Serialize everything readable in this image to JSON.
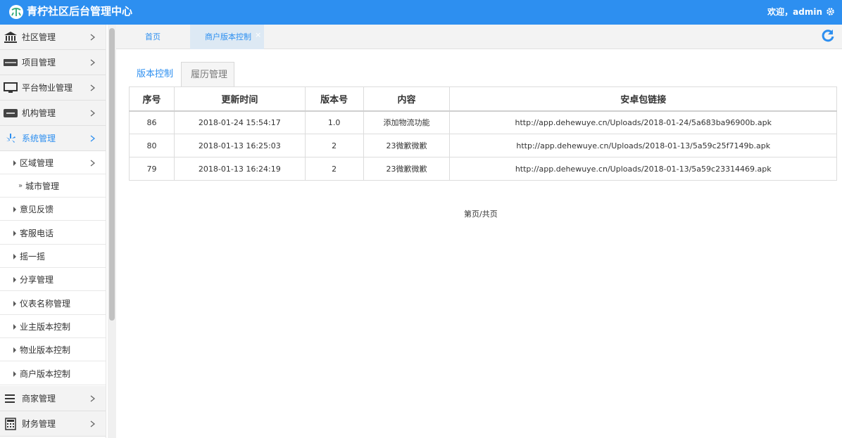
{
  "app": {
    "title": "青柠社区后台管理中心",
    "logo_icon": "leaf-logo-icon",
    "accent_color": "#2d8ff0"
  },
  "header": {
    "welcome": "欢迎，admin"
  },
  "sidebar": {
    "groups": [
      {
        "label": "社区管理",
        "icon": "bank-icon"
      },
      {
        "label": "项目管理",
        "icon": "card-icon"
      },
      {
        "label": "平台物业管理",
        "icon": "monitor-icon"
      },
      {
        "label": "机构管理",
        "icon": "stripe-icon"
      },
      {
        "label": "系统管理",
        "icon": "yelp-icon",
        "active": true
      }
    ],
    "sub_items": [
      {
        "label": "区域管理"
      },
      {
        "label": "城市管理",
        "mark": "»"
      },
      {
        "label": "意见反馈"
      },
      {
        "label": "客服电话"
      },
      {
        "label": "摇一摇"
      },
      {
        "label": "分享管理"
      },
      {
        "label": "仪表名称管理"
      },
      {
        "label": "业主版本控制"
      },
      {
        "label": "物业版本控制"
      },
      {
        "label": "商户版本控制"
      }
    ],
    "bottom_groups": [
      {
        "label": "商家管理",
        "icon": "bars-icon"
      },
      {
        "label": "财务管理",
        "icon": "calculator-icon"
      }
    ]
  },
  "tabs": [
    {
      "label": "首页"
    },
    {
      "label": "商户版本控制",
      "close": "×",
      "active": true
    }
  ],
  "subtabs": [
    {
      "label": "版本控制",
      "selected": true
    },
    {
      "label": "履历管理"
    }
  ],
  "table": {
    "headers": [
      "序号",
      "更新时间",
      "版本号",
      "内容",
      "安卓包链接"
    ],
    "rows": [
      [
        "86",
        "2018-01-24 15:54:17",
        "1.0",
        "添加物流功能",
        "http://app.dehewuye.cn/Uploads/2018-01-24/5a683ba96900b.apk"
      ],
      [
        "80",
        "2018-01-13 16:25:03",
        "2",
        "23微歉微歉",
        "http://app.dehewuye.cn/Uploads/2018-01-13/5a59c25f7149b.apk"
      ],
      [
        "79",
        "2018-01-13 16:24:19",
        "2",
        "23微歉微歉",
        "http://app.dehewuye.cn/Uploads/2018-01-13/5a59c23314469.apk"
      ]
    ]
  },
  "pager": {
    "text": "第页/共页"
  }
}
